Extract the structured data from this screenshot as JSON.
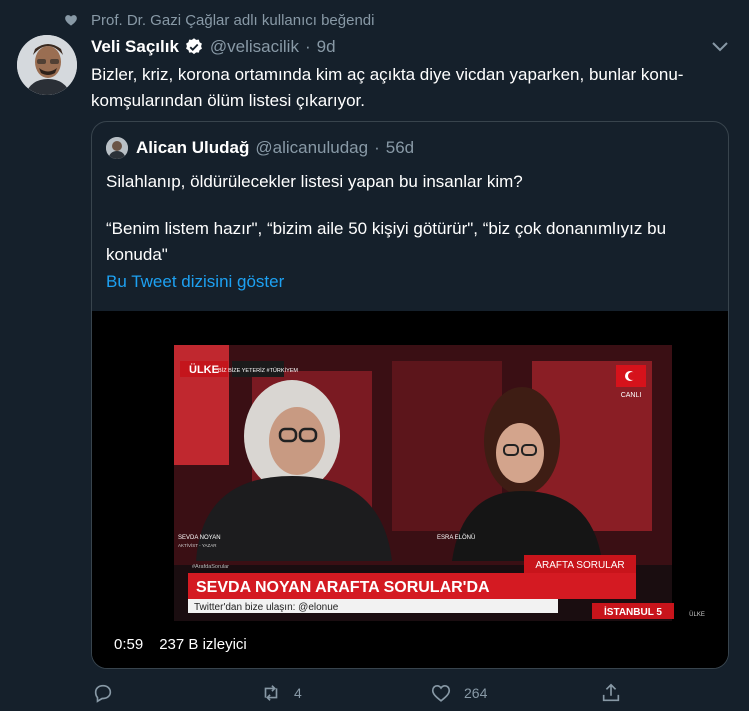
{
  "social_context": {
    "text": "Prof. Dr. Gazi Çağlar adlı kullanıcı beğendi"
  },
  "tweet": {
    "author_name": "Veli Saçılık",
    "handle": "@velisacilik",
    "separator": "·",
    "time": "9d",
    "text": "Bizler, kriz, korona ortamında kim aç açıkta diye vicdan yaparken, bunlar konu-komşularından ölüm listesi çıkarıyor."
  },
  "quoted": {
    "author_name": "Alican Uludağ",
    "handle": "@alicanuludag",
    "separator": "·",
    "time": "56d",
    "text_line1": "Silahlanıp, öldürülecekler listesi yapan bu insanlar kim?",
    "text_line2": "“Benim listem hazır\", “bizim aile 50 kişiyi götürür\", “biz çok donanımlıyız bu konuda\"",
    "thread_link": "Bu Tweet dizisini göster"
  },
  "video": {
    "duration": "0:59",
    "views": "237 B izleyici",
    "channel_logo": "ÜLKE",
    "hashtag_tag": "BİZ BİZE YETERİZ #TÜRKİYEM",
    "live_tag": "CANLI",
    "guest1_caption": "SEVDA NOYAN",
    "guest1_role": "AKTİVİST - YAZAR",
    "guest2_caption": "ESRA ELÖNÜ",
    "hashtag_handle": "#ArafdaSorular",
    "show_name": "ARAFTA SORULAR",
    "headline": "SEVDA NOYAN ARAFTA SORULAR'DA",
    "ticker": "Twitter'dan bize ulaşın: @elonue",
    "location": "İSTANBUL 5",
    "corner_logo": "ÜLKE"
  },
  "actions": {
    "reply_count": "",
    "retweet_count": "4",
    "like_count": "264"
  },
  "colors": {
    "background": "#15202b",
    "muted": "#8899a6",
    "accent": "#1da1f2",
    "border": "#38444d"
  },
  "icons": [
    "heart-icon",
    "verified-badge-icon",
    "chevron-down-icon",
    "reply-icon",
    "retweet-icon",
    "like-icon",
    "share-icon"
  ]
}
